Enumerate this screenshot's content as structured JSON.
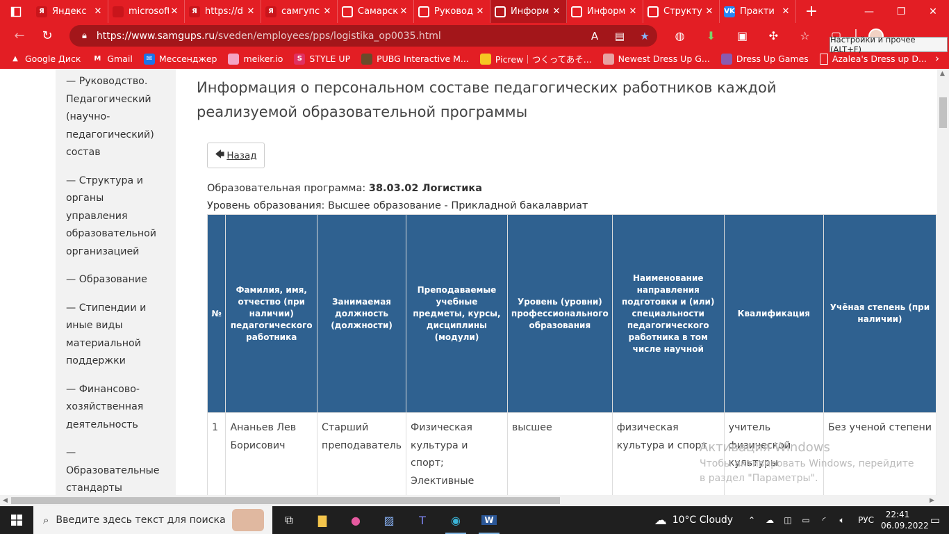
{
  "browser": {
    "tabs": [
      {
        "label": "Яндекс",
        "icon": "yandex-icon",
        "icon_text": "Я",
        "color": "#e31e24",
        "active": false
      },
      {
        "label": "microsoft",
        "icon": "document-icon",
        "icon_text": "",
        "color": "#e31e24",
        "active": false
      },
      {
        "label": "https://d",
        "icon": "yandex-icon",
        "icon_text": "Я",
        "color": "#e31e24",
        "active": false
      },
      {
        "label": "самгупс",
        "icon": "yandex-icon",
        "icon_text": "Я",
        "color": "#e31e24",
        "active": false
      },
      {
        "label": "Самарск",
        "icon": "samgups-icon",
        "icon_text": "",
        "color": "#e31e24",
        "active": false
      },
      {
        "label": "Руковод",
        "icon": "samgups-icon",
        "icon_text": "",
        "color": "#e31e24",
        "active": false
      },
      {
        "label": "Информ",
        "icon": "samgups-icon",
        "icon_text": "",
        "color": "#b5161b",
        "active": true
      },
      {
        "label": "Информ",
        "icon": "samgups-icon",
        "icon_text": "",
        "color": "#e31e24",
        "active": false
      },
      {
        "label": "Структу",
        "icon": "samgups-icon",
        "icon_text": "",
        "color": "#e31e24",
        "active": false
      },
      {
        "label": "Практи",
        "icon": "vk-icon",
        "icon_text": "VK",
        "color": "#e31e24",
        "active": false
      }
    ],
    "url_domain": "https://www.samgups.ru",
    "url_path": "/sveden/employees/pps/logistika_op0035.html",
    "tooltip": "Настройки и прочее (ALT+F)",
    "bookmarks": [
      {
        "label": "Google Диск",
        "icon": "google-drive-icon",
        "icon_text": "▲",
        "bg": "#e31e24"
      },
      {
        "label": "Gmail",
        "icon": "gmail-icon",
        "icon_text": "M",
        "bg": "#e31e24"
      },
      {
        "label": "Мессенджер",
        "icon": "messenger-icon",
        "icon_text": "✉",
        "bg": "#1a73e8"
      },
      {
        "label": "meiker.io",
        "icon": "meiker-icon",
        "icon_text": "",
        "bg": "#f4a3c4"
      },
      {
        "label": "STYLE UP",
        "icon": "styleup-icon",
        "icon_text": "S",
        "bg": "#e03060"
      },
      {
        "label": "PUBG Interactive M...",
        "icon": "pubg-icon",
        "icon_text": "",
        "bg": "#6b4a2a"
      },
      {
        "label": "Picrew｜つくってあそ...",
        "icon": "picrew-icon",
        "icon_text": "",
        "bg": "#f6c623"
      },
      {
        "label": "Newest Dress Up G...",
        "icon": "dressup-icon",
        "icon_text": "",
        "bg": "#e8a2a2"
      },
      {
        "label": "Dress Up Games",
        "icon": "dressup-games-icon",
        "icon_text": "",
        "bg": "#8a5ab0"
      },
      {
        "label": "Azalea's Dress up D...",
        "icon": "document-icon",
        "icon_text": "",
        "bg": "transparent"
      }
    ]
  },
  "sidebar": {
    "items": [
      "— Руководство. Педагогический (научно-педагогический) состав",
      "— Структура и органы управления образовательной организацией",
      "— Образование",
      "— Стипендии и иные виды материальной поддержки",
      "— Финансово-хозяйственная деятельность",
      "— Образовательные стандарты"
    ]
  },
  "main": {
    "title": "Информация о персональном составе педагогических работников каждой реализуемой образовательной программы",
    "back_label": "Назад",
    "program_label": "Образовательная программа: ",
    "program_value": "38.03.02 Логистика",
    "level": "Уровень образования: Высшее образование - Прикладной бакалавриат",
    "table": {
      "headers": [
        "№",
        "Фамилия, имя, отчество (при наличии) педагогического работника",
        "Занимаемая должность (должности)",
        "Преподаваемые учебные предметы, курсы, дисциплины (модули)",
        "Уровень (уровни) профессионального образования",
        "Наименование направления подготовки и (или) специальности педагогического работника в том числе научной",
        "Квалификация",
        "Учёная степень (при наличии)"
      ],
      "rows": [
        [
          "1",
          "Ананьев Лев Борисович",
          "Старший преподаватель",
          "Физическая культура и спорт; Элективные курсы по физической культуре",
          "высшее",
          "физическая культура и спорт",
          "учитель физической культуры",
          "Без ученой степени"
        ]
      ]
    }
  },
  "watermark": {
    "line1": "Активация Windows",
    "line2": "Чтобы активировать Windows, перейдите в раздел \"Параметры\"."
  },
  "taskbar": {
    "search_placeholder": "Введите здесь текст для поиска",
    "weather": "10°C  Cloudy",
    "lang": "РУС",
    "time": "22:41",
    "date": "06.09.2022"
  }
}
